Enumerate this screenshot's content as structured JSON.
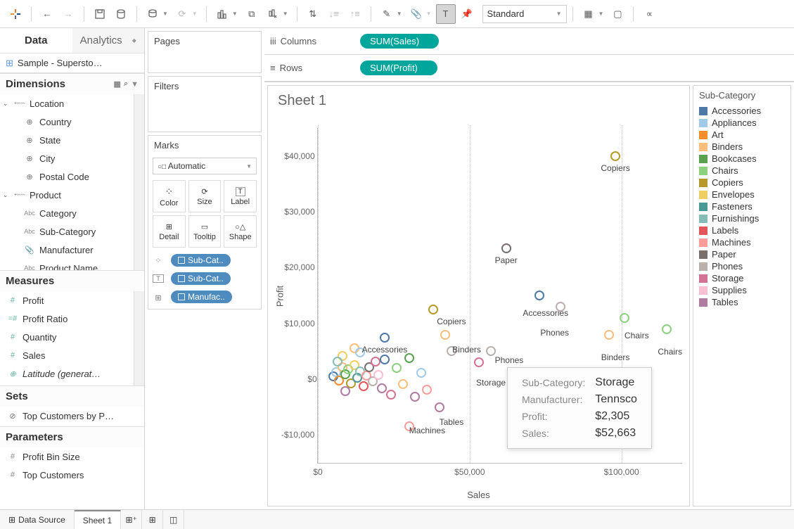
{
  "toolbar": {
    "view_mode": "Standard"
  },
  "data_panel": {
    "tabs": [
      "Data",
      "Analytics"
    ],
    "datasource": "Sample - Supersto…",
    "dimensions_label": "Dimensions",
    "measures_label": "Measures",
    "sets_label": "Sets",
    "parameters_label": "Parameters",
    "dimensions": {
      "location": {
        "label": "Location",
        "children": [
          "Country",
          "State",
          "City",
          "Postal Code"
        ]
      },
      "product": {
        "label": "Product",
        "children": [
          "Category",
          "Sub-Category",
          "Manufacturer",
          "Product Name"
        ]
      }
    },
    "measures": [
      "Profit",
      "Profit Ratio",
      "Quantity",
      "Sales",
      "Latitude (generat…"
    ],
    "sets": [
      "Top Customers by P…"
    ],
    "parameters": [
      "Profit Bin Size",
      "Top Customers"
    ]
  },
  "cards": {
    "pages": "Pages",
    "filters": "Filters",
    "marks": "Marks",
    "marks_type": "Automatic",
    "mark_buttons": [
      "Color",
      "Size",
      "Label",
      "Detail",
      "Tooltip",
      "Shape"
    ],
    "mark_pills": [
      "Sub-Cat..",
      "Sub-Cat..",
      "Manufac.."
    ]
  },
  "shelves": {
    "columns_label": "Columns",
    "rows_label": "Rows",
    "columns_pill": "SUM(Sales)",
    "rows_pill": "SUM(Profit)"
  },
  "sheet_title": "Sheet 1",
  "legend": {
    "title": "Sub-Category",
    "items": [
      {
        "label": "Accessories",
        "color": "#4e79a7"
      },
      {
        "label": "Appliances",
        "color": "#a0cbe8"
      },
      {
        "label": "Art",
        "color": "#f28e2b"
      },
      {
        "label": "Binders",
        "color": "#ffbe7d"
      },
      {
        "label": "Bookcases",
        "color": "#59a14f"
      },
      {
        "label": "Chairs",
        "color": "#8cd17d"
      },
      {
        "label": "Copiers",
        "color": "#b6992d"
      },
      {
        "label": "Envelopes",
        "color": "#f1ce63"
      },
      {
        "label": "Fasteners",
        "color": "#499894"
      },
      {
        "label": "Furnishings",
        "color": "#86bcb6"
      },
      {
        "label": "Labels",
        "color": "#e15759"
      },
      {
        "label": "Machines",
        "color": "#ff9d9a"
      },
      {
        "label": "Paper",
        "color": "#79706e"
      },
      {
        "label": "Phones",
        "color": "#bab0ac"
      },
      {
        "label": "Storage",
        "color": "#d37295"
      },
      {
        "label": "Supplies",
        "color": "#fabfd2"
      },
      {
        "label": "Tables",
        "color": "#b07aa1"
      }
    ]
  },
  "tooltip": {
    "rows": [
      {
        "k": "Sub-Category:",
        "v": "Storage"
      },
      {
        "k": "Manufacturer:",
        "v": "Tennsco"
      },
      {
        "k": "Profit:",
        "v": "$2,305"
      },
      {
        "k": "Sales:",
        "v": "$52,663"
      }
    ]
  },
  "bottom": {
    "datasource": "Data Source",
    "sheet": "Sheet 1"
  },
  "chart_data": {
    "type": "scatter",
    "title": "Sheet 1",
    "xlabel": "Sales",
    "ylabel": "Profit",
    "xlim": [
      0,
      120000
    ],
    "ylim": [
      -15000,
      45000
    ],
    "xticks": [
      {
        "v": 0,
        "l": "$0"
      },
      {
        "v": 50000,
        "l": "$50,000"
      },
      {
        "v": 100000,
        "l": "$100,000"
      }
    ],
    "yticks": [
      {
        "v": -10000,
        "l": "-$10,000"
      },
      {
        "v": 0,
        "l": "$0"
      },
      {
        "v": 10000,
        "l": "$10,000"
      },
      {
        "v": 20000,
        "l": "$20,000"
      },
      {
        "v": 30000,
        "l": "$30,000"
      },
      {
        "v": 40000,
        "l": "$40,000"
      }
    ],
    "labeled_points": [
      {
        "x": 98000,
        "y": 40000,
        "label": "Copiers",
        "color": "#b6992d"
      },
      {
        "x": 62000,
        "y": 23500,
        "label": "Paper",
        "color": "#79706e"
      },
      {
        "x": 73000,
        "y": 15000,
        "label": "Accessories",
        "color": "#4e79a7",
        "lx": 75000,
        "ly": 14000
      },
      {
        "x": 38000,
        "y": 12500,
        "label": "Copiers",
        "color": "#b6992d",
        "lx": 44000,
        "ly": 12500
      },
      {
        "x": 80000,
        "y": 13000,
        "label": "Phones",
        "color": "#bab0ac",
        "lx": 78000,
        "ly": 10500
      },
      {
        "x": 101000,
        "y": 11000,
        "label": "Chairs",
        "color": "#8cd17d",
        "lx": 105000,
        "ly": 10000
      },
      {
        "x": 115000,
        "y": 9000,
        "label": "Chairs",
        "color": "#8cd17d",
        "lx": 116000,
        "ly": 7000
      },
      {
        "x": 96000,
        "y": 8000,
        "label": "Binders",
        "color": "#ffbe7d",
        "lx": 98000,
        "ly": 6000
      },
      {
        "x": 42000,
        "y": 8000,
        "label": "Binders",
        "color": "#ffbe7d",
        "lx": 49000,
        "ly": 7500
      },
      {
        "x": 22000,
        "y": 7500,
        "label": "Accessories",
        "color": "#4e79a7",
        "lx": 22000,
        "ly": 7500
      },
      {
        "x": 57000,
        "y": 5000,
        "label": "Phones",
        "color": "#bab0ac",
        "lx": 63000,
        "ly": 5500
      },
      {
        "x": 53000,
        "y": 3000,
        "label": "Storage",
        "color": "#d37295",
        "lx": 57000,
        "ly": 1500
      },
      {
        "x": 40000,
        "y": -5000,
        "label": "Tables",
        "color": "#b07aa1",
        "lx": 44000,
        "ly": -5500
      },
      {
        "x": 30000,
        "y": -8500,
        "label": "Machines",
        "color": "#ff9d9a",
        "lx": 36000,
        "ly": -7000
      }
    ],
    "cloud_points": [
      {
        "x": 5000,
        "y": 500,
        "c": "#4e79a7"
      },
      {
        "x": 6000,
        "y": 1200,
        "c": "#a0cbe8"
      },
      {
        "x": 7000,
        "y": -300,
        "c": "#f28e2b"
      },
      {
        "x": 8000,
        "y": 2200,
        "c": "#ffbe7d"
      },
      {
        "x": 9000,
        "y": 900,
        "c": "#59a14f"
      },
      {
        "x": 10000,
        "y": 1800,
        "c": "#8cd17d"
      },
      {
        "x": 11000,
        "y": -800,
        "c": "#b6992d"
      },
      {
        "x": 12000,
        "y": 2500,
        "c": "#f1ce63"
      },
      {
        "x": 13000,
        "y": 300,
        "c": "#499894"
      },
      {
        "x": 14000,
        "y": 1400,
        "c": "#86bcb6"
      },
      {
        "x": 15000,
        "y": -1200,
        "c": "#e15759"
      },
      {
        "x": 16000,
        "y": 600,
        "c": "#ff9d9a"
      },
      {
        "x": 17000,
        "y": 2100,
        "c": "#79706e"
      },
      {
        "x": 18000,
        "y": -400,
        "c": "#bab0ac"
      },
      {
        "x": 19000,
        "y": 3100,
        "c": "#d37295"
      },
      {
        "x": 20000,
        "y": 700,
        "c": "#fabfd2"
      },
      {
        "x": 21000,
        "y": -1700,
        "c": "#b07aa1"
      },
      {
        "x": 22000,
        "y": 3500,
        "c": "#4e79a7"
      },
      {
        "x": 24000,
        "y": -2800,
        "c": "#d37295"
      },
      {
        "x": 26000,
        "y": 2000,
        "c": "#8cd17d"
      },
      {
        "x": 28000,
        "y": -900,
        "c": "#ffbe7d"
      },
      {
        "x": 30000,
        "y": 3800,
        "c": "#59a14f"
      },
      {
        "x": 32000,
        "y": -3200,
        "c": "#b07aa1"
      },
      {
        "x": 34000,
        "y": 1100,
        "c": "#a0cbe8"
      },
      {
        "x": 36000,
        "y": -1900,
        "c": "#ff9d9a"
      },
      {
        "x": 8000,
        "y": 4200,
        "c": "#f1ce63"
      },
      {
        "x": 12000,
        "y": 5600,
        "c": "#ffbe7d"
      },
      {
        "x": 9000,
        "y": -2200,
        "c": "#b07aa1"
      },
      {
        "x": 14000,
        "y": 4800,
        "c": "#a0cbe8"
      },
      {
        "x": 6500,
        "y": 3200,
        "c": "#86bcb6"
      },
      {
        "x": 44000,
        "y": 5000,
        "c": "#bab0ac"
      }
    ]
  }
}
